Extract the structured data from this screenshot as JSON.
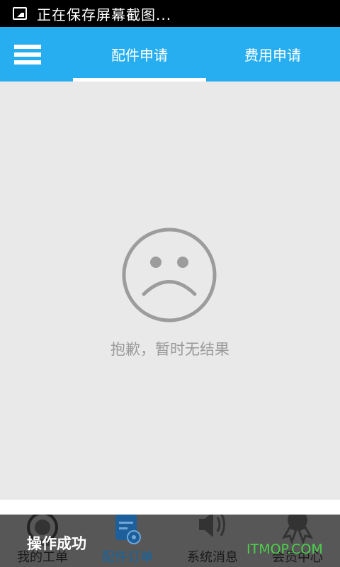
{
  "status_bar": {
    "notification_text": "正在保存屏幕截图..."
  },
  "header": {
    "tabs": [
      {
        "label": "配件申请",
        "active": true
      },
      {
        "label": "费用申请",
        "active": false
      }
    ]
  },
  "empty_state": {
    "message": "抱歉，暂时无结果"
  },
  "bottom_nav": {
    "items": [
      {
        "label": "我的工单",
        "icon": "person-icon"
      },
      {
        "label": "配件订单",
        "icon": "clipboard-gear-icon",
        "active": true
      },
      {
        "label": "系统消息",
        "icon": "speaker-icon"
      },
      {
        "label": "会员中心",
        "icon": "medal-icon"
      }
    ]
  },
  "toast": {
    "text": "操作成功"
  },
  "watermark": {
    "text": "ITMOP.COM"
  },
  "colors": {
    "accent": "#27aef0",
    "nav_active": "#1565a0",
    "watermark": "#4cd04a"
  }
}
